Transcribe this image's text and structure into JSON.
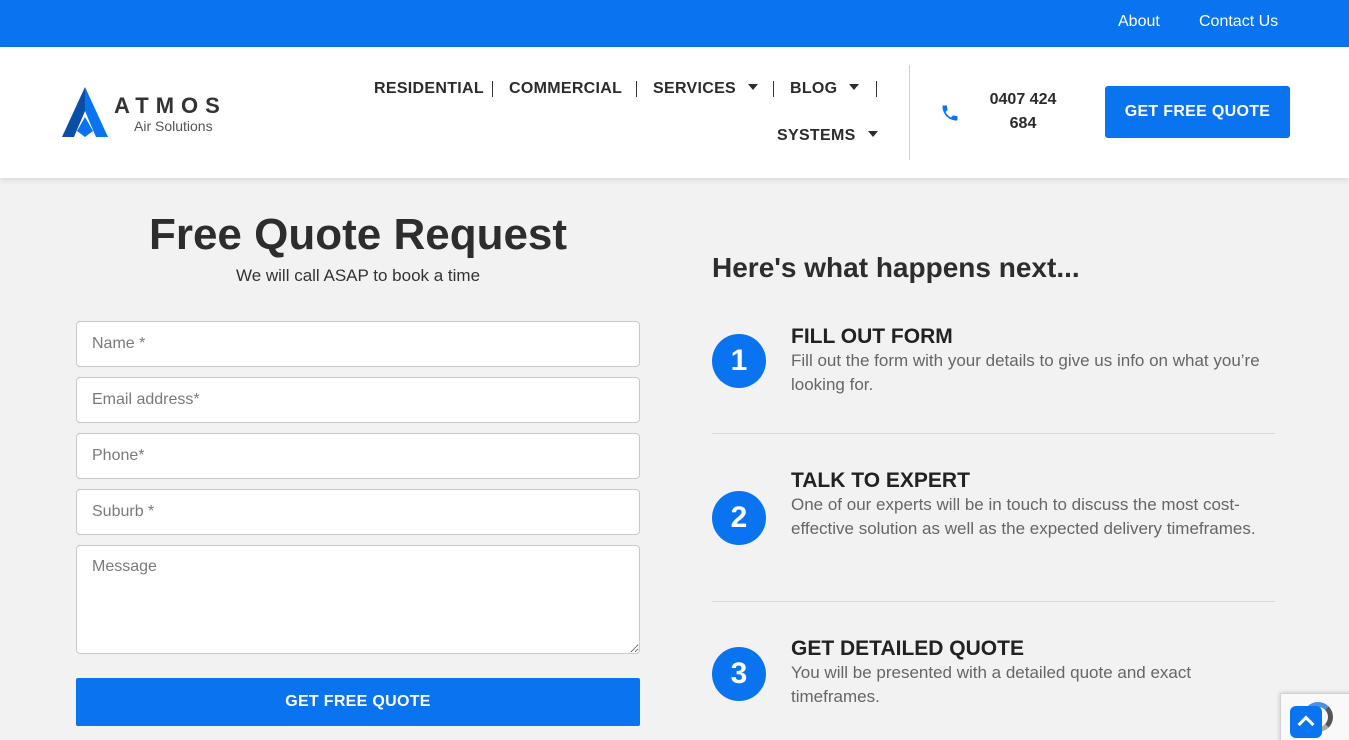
{
  "topbar": {
    "about": "About",
    "contact": "Contact Us"
  },
  "logo": {
    "brand": "ATMOS",
    "sub": "Air Solutions"
  },
  "nav": {
    "residential": "RESIDENTIAL",
    "commercial": "COMMERCIAL",
    "services": "SERVICES",
    "blog": "BLOG",
    "systems": "SYSTEMS"
  },
  "header": {
    "phone": "0407 424 684",
    "quote_button": "GET FREE QUOTE"
  },
  "form": {
    "title": "Free Quote Request",
    "subtitle": "We will call ASAP to book a time",
    "name_placeholder": "Name *",
    "email_placeholder": "Email address*",
    "phone_placeholder": "Phone*",
    "suburb_placeholder": "Suburb *",
    "message_placeholder": "Message",
    "submit": "GET FREE QUOTE"
  },
  "next": {
    "title": "Here's what happens next...",
    "steps": [
      {
        "num": "1",
        "title": "FILL OUT FORM",
        "desc": "Fill out the form with your details to give us info on what you’re looking for."
      },
      {
        "num": "2",
        "title": "TALK TO EXPERT",
        "desc": "One of our experts will be in touch to discuss the most cost-effective solution as well as the expected delivery timeframes."
      },
      {
        "num": "3",
        "title": "GET DETAILED QUOTE",
        "desc": "You will be presented with a detailed quote and exact timeframes."
      }
    ]
  },
  "colors": {
    "accent": "#0a73f0",
    "background": "#f2f2f2"
  },
  "icons": {
    "phone": "phone-icon",
    "scroll_top": "chevron-up-icon",
    "recaptcha": "recaptcha-icon"
  }
}
